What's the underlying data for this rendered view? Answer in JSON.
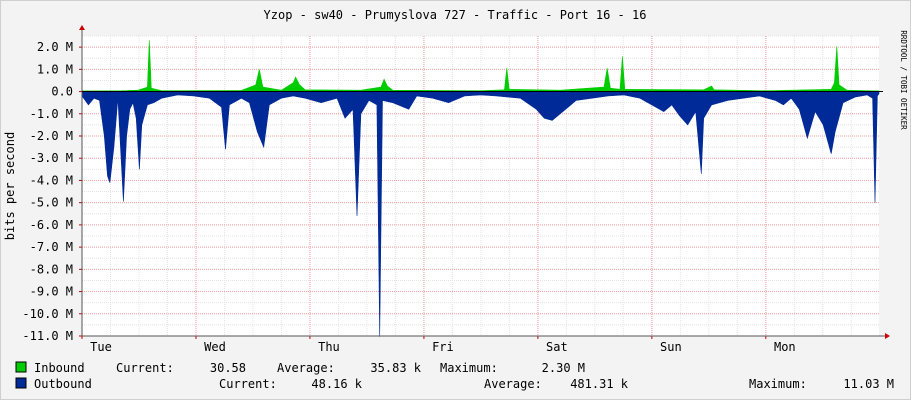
{
  "chart_data": {
    "type": "area",
    "title": "Yzop - sw40 - Prumyslova 727 - Traffic - Port 16 - 16",
    "ylabel": "bits per second",
    "watermark": "RRDTOOL / TOBI OETIKER",
    "ylim": [
      -11000000,
      2500000
    ],
    "xlim": [
      0,
      1
    ],
    "y_ticks": [
      {
        "value": 2000000,
        "label": "2.0 M"
      },
      {
        "value": 1000000,
        "label": "1.0 M"
      },
      {
        "value": 0,
        "label": "0.0"
      },
      {
        "value": -1000000,
        "label": "-1.0 M"
      },
      {
        "value": -2000000,
        "label": "-2.0 M"
      },
      {
        "value": -3000000,
        "label": "-3.0 M"
      },
      {
        "value": -4000000,
        "label": "-4.0 M"
      },
      {
        "value": -5000000,
        "label": "-5.0 M"
      },
      {
        "value": -6000000,
        "label": "-6.0 M"
      },
      {
        "value": -7000000,
        "label": "-7.0 M"
      },
      {
        "value": -8000000,
        "label": "-8.0 M"
      },
      {
        "value": -9000000,
        "label": "-9.0 M"
      },
      {
        "value": -10000000,
        "label": "-10.0 M"
      },
      {
        "value": -11000000,
        "label": "-11.0 M"
      }
    ],
    "x_ticks": [
      {
        "value": 0.0,
        "label": "Tue"
      },
      {
        "value": 0.143,
        "label": "Wed"
      },
      {
        "value": 0.286,
        "label": "Thu"
      },
      {
        "value": 0.429,
        "label": "Fri"
      },
      {
        "value": 0.572,
        "label": "Sat"
      },
      {
        "value": 0.715,
        "label": "Sun"
      },
      {
        "value": 0.858,
        "label": "Mon"
      }
    ],
    "series": [
      {
        "name": "Inbound",
        "color": "#00cc00",
        "current": "30.58",
        "average": "35.83 k",
        "maximum": "2.30 M",
        "points": [
          [
            0.0,
            30000
          ],
          [
            0.05,
            40000
          ],
          [
            0.07,
            60000
          ],
          [
            0.082,
            200000
          ],
          [
            0.0845,
            2300000
          ],
          [
            0.087,
            150000
          ],
          [
            0.1,
            40000
          ],
          [
            0.2,
            50000
          ],
          [
            0.218,
            300000
          ],
          [
            0.2225,
            1000000
          ],
          [
            0.227,
            200000
          ],
          [
            0.25,
            60000
          ],
          [
            0.265,
            400000
          ],
          [
            0.268,
            650000
          ],
          [
            0.273,
            300000
          ],
          [
            0.28,
            80000
          ],
          [
            0.35,
            60000
          ],
          [
            0.375,
            200000
          ],
          [
            0.379,
            550000
          ],
          [
            0.383,
            250000
          ],
          [
            0.39,
            60000
          ],
          [
            0.5,
            40000
          ],
          [
            0.53,
            80000
          ],
          [
            0.533,
            1050000
          ],
          [
            0.536,
            100000
          ],
          [
            0.6,
            60000
          ],
          [
            0.655,
            200000
          ],
          [
            0.659,
            1050000
          ],
          [
            0.663,
            150000
          ],
          [
            0.675,
            100000
          ],
          [
            0.678,
            1580000
          ],
          [
            0.681,
            100000
          ],
          [
            0.78,
            80000
          ],
          [
            0.79,
            250000
          ],
          [
            0.793,
            80000
          ],
          [
            0.86,
            40000
          ],
          [
            0.94,
            100000
          ],
          [
            0.944,
            400000
          ],
          [
            0.947,
            2030000
          ],
          [
            0.95,
            300000
          ],
          [
            0.96,
            60000
          ],
          [
            1.0,
            30000
          ]
        ]
      },
      {
        "name": "Outbound",
        "color": "#002a97",
        "current": "48.16 k",
        "average": "481.31 k",
        "maximum": "11.03 M",
        "points": [
          [
            0.0,
            -200000
          ],
          [
            0.008,
            -600000
          ],
          [
            0.015,
            -300000
          ],
          [
            0.022,
            -400000
          ],
          [
            0.028,
            -2000000
          ],
          [
            0.032,
            -3800000
          ],
          [
            0.035,
            -4100000
          ],
          [
            0.04,
            -2500000
          ],
          [
            0.045,
            -300000
          ],
          [
            0.052,
            -4950000
          ],
          [
            0.056,
            -2000000
          ],
          [
            0.06,
            -800000
          ],
          [
            0.064,
            -500000
          ],
          [
            0.068,
            -1200000
          ],
          [
            0.072,
            -3500000
          ],
          [
            0.075,
            -1500000
          ],
          [
            0.082,
            -600000
          ],
          [
            0.09,
            -500000
          ],
          [
            0.1,
            -300000
          ],
          [
            0.12,
            -150000
          ],
          [
            0.14,
            -200000
          ],
          [
            0.16,
            -300000
          ],
          [
            0.175,
            -700000
          ],
          [
            0.18,
            -2600000
          ],
          [
            0.185,
            -600000
          ],
          [
            0.2,
            -300000
          ],
          [
            0.21,
            -500000
          ],
          [
            0.22,
            -1800000
          ],
          [
            0.228,
            -2500000
          ],
          [
            0.235,
            -600000
          ],
          [
            0.25,
            -300000
          ],
          [
            0.265,
            -200000
          ],
          [
            0.28,
            -300000
          ],
          [
            0.3,
            -500000
          ],
          [
            0.32,
            -300000
          ],
          [
            0.33,
            -1200000
          ],
          [
            0.34,
            -800000
          ],
          [
            0.345,
            -5600000
          ],
          [
            0.35,
            -1000000
          ],
          [
            0.36,
            -400000
          ],
          [
            0.37,
            -600000
          ],
          [
            0.3735,
            -11030000
          ],
          [
            0.377,
            -400000
          ],
          [
            0.39,
            -500000
          ],
          [
            0.41,
            -800000
          ],
          [
            0.42,
            -200000
          ],
          [
            0.44,
            -300000
          ],
          [
            0.46,
            -500000
          ],
          [
            0.48,
            -200000
          ],
          [
            0.5,
            -150000
          ],
          [
            0.52,
            -200000
          ],
          [
            0.55,
            -300000
          ],
          [
            0.57,
            -800000
          ],
          [
            0.58,
            -1200000
          ],
          [
            0.59,
            -1300000
          ],
          [
            0.6,
            -1000000
          ],
          [
            0.61,
            -700000
          ],
          [
            0.62,
            -400000
          ],
          [
            0.64,
            -300000
          ],
          [
            0.66,
            -200000
          ],
          [
            0.68,
            -150000
          ],
          [
            0.7,
            -300000
          ],
          [
            0.72,
            -700000
          ],
          [
            0.73,
            -900000
          ],
          [
            0.74,
            -600000
          ],
          [
            0.75,
            -1100000
          ],
          [
            0.76,
            -1500000
          ],
          [
            0.77,
            -900000
          ],
          [
            0.777,
            -3700000
          ],
          [
            0.78,
            -1200000
          ],
          [
            0.79,
            -600000
          ],
          [
            0.81,
            -400000
          ],
          [
            0.83,
            -300000
          ],
          [
            0.85,
            -200000
          ],
          [
            0.87,
            -400000
          ],
          [
            0.88,
            -600000
          ],
          [
            0.89,
            -300000
          ],
          [
            0.9,
            -800000
          ],
          [
            0.91,
            -2100000
          ],
          [
            0.92,
            -900000
          ],
          [
            0.93,
            -1500000
          ],
          [
            0.94,
            -2800000
          ],
          [
            0.945,
            -1800000
          ],
          [
            0.955,
            -500000
          ],
          [
            0.97,
            -250000
          ],
          [
            0.985,
            -150000
          ],
          [
            0.992,
            -300000
          ],
          [
            0.995,
            -5000000
          ],
          [
            0.998,
            -200000
          ],
          [
            1.0,
            -100000
          ]
        ]
      }
    ]
  },
  "legend": {
    "current_label": "Current:",
    "average_label": "Average:",
    "maximum_label": "Maximum:"
  }
}
